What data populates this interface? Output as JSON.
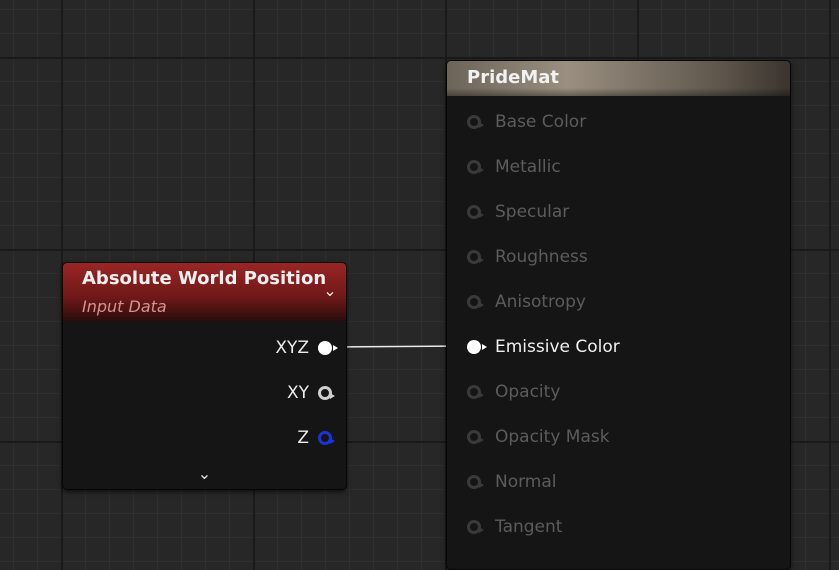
{
  "position_node": {
    "title": "Absolute World Position",
    "subtitle": "Input Data",
    "collapse_icon": "chevron-down-icon",
    "outputs": [
      {
        "label": "XYZ",
        "pin": "filled-white"
      },
      {
        "label": "XY",
        "pin": "hollow-white"
      },
      {
        "label": "Z",
        "pin": "hollow-blue"
      }
    ],
    "header_color": "#8b2020"
  },
  "material_node": {
    "title": "PrideMat",
    "inputs": [
      {
        "label": "Base Color",
        "active": false
      },
      {
        "label": "Metallic",
        "active": false
      },
      {
        "label": "Specular",
        "active": false
      },
      {
        "label": "Roughness",
        "active": false
      },
      {
        "label": "Anisotropy",
        "active": false
      },
      {
        "label": "Emissive Color",
        "active": true
      },
      {
        "label": "Opacity",
        "active": false
      },
      {
        "label": "Opacity Mask",
        "active": false
      },
      {
        "label": "Normal",
        "active": false
      },
      {
        "label": "Tangent",
        "active": false
      }
    ]
  },
  "connection": {
    "from": "XYZ",
    "to": "Emissive Color",
    "color": "#ffffff"
  }
}
